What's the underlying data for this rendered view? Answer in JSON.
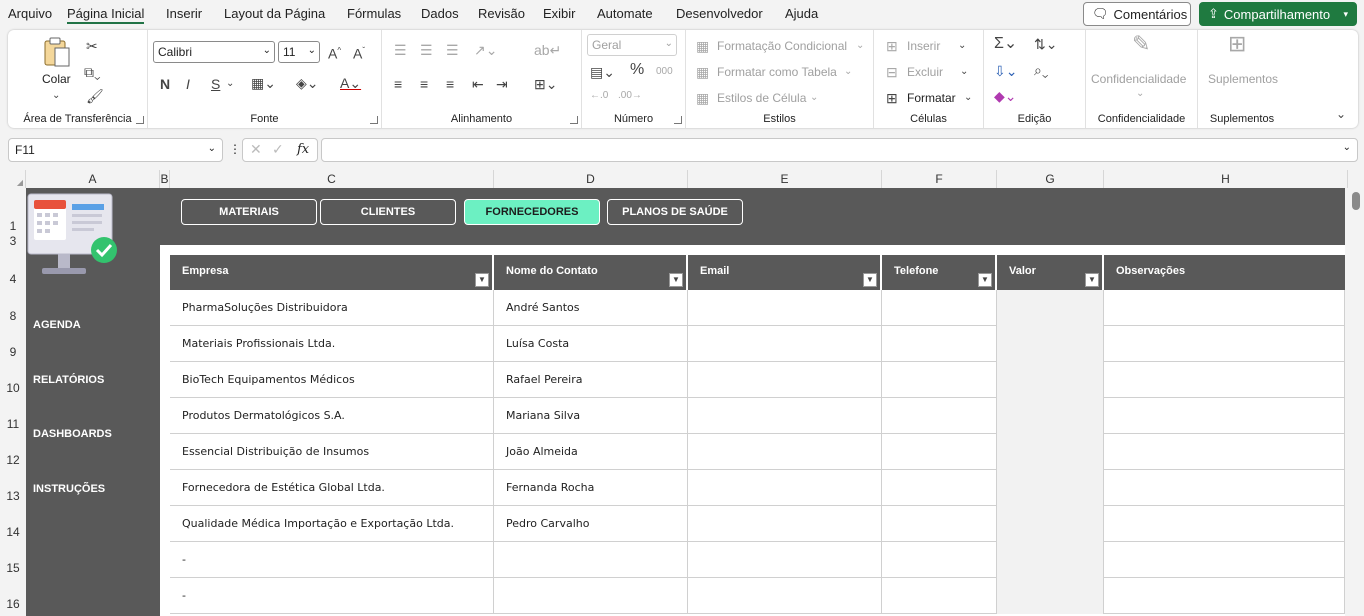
{
  "menu": {
    "items": [
      "Arquivo",
      "Página Inicial",
      "Inserir",
      "Layout da Página",
      "Fórmulas",
      "Dados",
      "Revisão",
      "Exibir",
      "Automate",
      "Desenvolvedor",
      "Ajuda"
    ],
    "active": "Página Inicial",
    "comments_label": "Comentários",
    "share_label": "Compartilhamento"
  },
  "ribbon": {
    "clipboard": {
      "paste_label": "Colar",
      "group_label": "Área de Transferência"
    },
    "font": {
      "name": "Calibri",
      "size": "11",
      "group_label": "Fonte",
      "bold": "N",
      "italic": "I",
      "underline": "S"
    },
    "alignment": {
      "group_label": "Alinhamento"
    },
    "number": {
      "format": "Geral",
      "group_label": "Número"
    },
    "styles": {
      "conditional": "Formatação Condicional",
      "table": "Formatar como Tabela",
      "cell_styles": "Estilos de Célula",
      "group_label": "Estilos"
    },
    "cells": {
      "insert": "Inserir",
      "delete": "Excluir",
      "format": "Formatar",
      "group_label": "Células"
    },
    "editing": {
      "group_label": "Edição"
    },
    "sensitivity": {
      "label": "Confidencialidade",
      "group_label": "Confidencialidade"
    },
    "addins": {
      "label": "Suplementos",
      "group_label": "Suplementos"
    }
  },
  "formula_bar": {
    "cell_ref": "F11",
    "fx": "fx",
    "value": ""
  },
  "grid": {
    "columns": [
      "A",
      "B",
      "C",
      "D",
      "E",
      "F",
      "G",
      "H"
    ],
    "rows": [
      "1",
      "3",
      "4",
      "8",
      "9",
      "10",
      "11",
      "12",
      "13",
      "14",
      "15",
      "16"
    ]
  },
  "dashboard": {
    "nav_buttons": [
      "MATERIAIS",
      "CLIENTES",
      "FORNECEDORES",
      "PLANOS DE SAÚDE"
    ],
    "active_nav": "FORNECEDORES",
    "sidebar": [
      "AGENDA",
      "RELATÓRIOS",
      "DASHBOARDS",
      "INSTRUÇÕES"
    ],
    "accent_color": "#6cf0c2",
    "dark_color": "#595959"
  },
  "table": {
    "headers": [
      "Empresa",
      "Nome do Contato",
      "Email",
      "Telefone",
      "Valor",
      "Observações"
    ],
    "rows": [
      [
        "PharmaSoluções Distribuidora",
        "André Santos",
        "",
        "",
        "",
        ""
      ],
      [
        "Materiais Profissionais Ltda.",
        "Luísa Costa",
        "",
        "",
        "",
        ""
      ],
      [
        "BioTech Equipamentos Médicos",
        "Rafael Pereira",
        "",
        "",
        "",
        ""
      ],
      [
        "Produtos Dermatológicos S.A.",
        "Mariana Silva",
        "",
        "",
        "",
        ""
      ],
      [
        "Essencial Distribuição de Insumos",
        "João Almeida",
        "",
        "",
        "",
        ""
      ],
      [
        "Fornecedora de Estética Global Ltda.",
        "Fernanda Rocha",
        "",
        "",
        "",
        ""
      ],
      [
        "Qualidade Médica Importação e Exportação Ltda.",
        "Pedro Carvalho",
        "",
        "",
        "",
        ""
      ],
      [
        "-",
        "",
        "",
        "",
        "",
        ""
      ],
      [
        "-",
        "",
        "",
        "",
        "",
        ""
      ]
    ]
  }
}
